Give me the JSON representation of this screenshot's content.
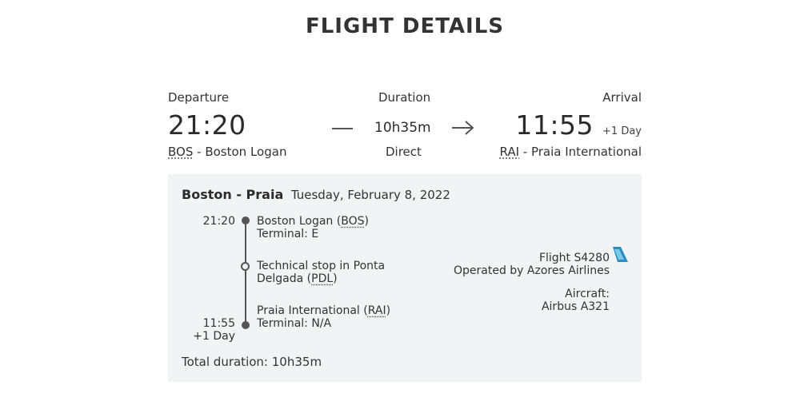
{
  "header": {
    "title": "FLIGHT DETAILS"
  },
  "summary": {
    "departure_label": "Departure",
    "departure_time": "21:20",
    "departure_code": "BOS",
    "departure_airport": "Boston Logan",
    "duration_label": "Duration",
    "duration_value": "10h35m",
    "stops": "Direct",
    "arrival_label": "Arrival",
    "arrival_time": "11:55",
    "arrival_day_offset": "+1 Day",
    "arrival_code": "RAI",
    "arrival_airport": "Praia International",
    "separator": "-"
  },
  "details": {
    "origin_city": "Boston",
    "destination_city": "Praia",
    "route_separator": "-",
    "date": "Tuesday, February 8, 2022",
    "segments": [
      {
        "time": "21:20",
        "airport": "Boston Logan",
        "code": "BOS",
        "terminal": "Terminal: E"
      },
      {
        "stop_text_1": "Technical stop in Ponta",
        "stop_text_2": "Delgada",
        "code": "PDL"
      },
      {
        "time": "11:55",
        "day_offset": "+1 Day",
        "airport": "Praia International",
        "code": "RAI",
        "terminal": "Terminal: N/A"
      }
    ],
    "flight_number": "Flight S4280",
    "operated_by": "Operated by Azores Airlines",
    "aircraft_label": "Aircraft:",
    "aircraft_model": "Airbus A321",
    "total_duration_label": "Total duration:",
    "total_duration_value": "10h35m"
  },
  "icons": {
    "arrow": "arrow-right-icon",
    "airline_logo": "azores-airlines-tail-icon"
  },
  "colors": {
    "panel_background": "#f2f3f5",
    "text": "#333333",
    "logo_blue": "#2a8fc0"
  }
}
